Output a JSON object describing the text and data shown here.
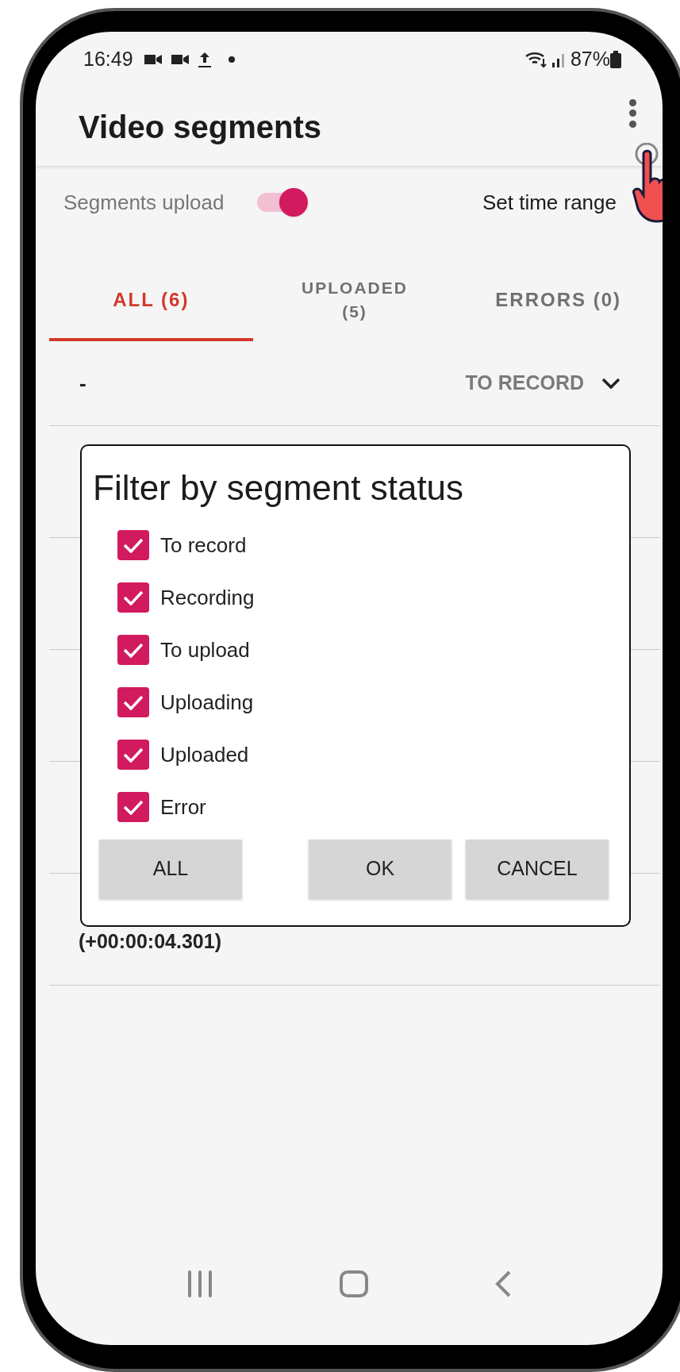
{
  "status_bar": {
    "time": "16:49",
    "battery": "87%"
  },
  "app_bar": {
    "title": "Video segments"
  },
  "controls": {
    "upload_toggle": {
      "label": "Segments upload",
      "on": true
    },
    "time_range": "Set time range"
  },
  "tabs": [
    {
      "label": "ALL (6)",
      "selected": true
    },
    {
      "label": "UPLOADED (5)",
      "selected": false
    },
    {
      "label": "ERRORS (0)",
      "selected": false
    }
  ],
  "filter_row": {
    "value": "-",
    "sort": "TO RECORD"
  },
  "segments": [
    {
      "text": "(+00:00:04.301)"
    }
  ],
  "dialog": {
    "title": "Filter by segment status",
    "options": [
      {
        "label": "To record",
        "checked": true
      },
      {
        "label": "Recording",
        "checked": true
      },
      {
        "label": "To upload",
        "checked": true
      },
      {
        "label": "Uploading",
        "checked": true
      },
      {
        "label": "Uploaded",
        "checked": true
      },
      {
        "label": "Error",
        "checked": true
      }
    ],
    "buttons": [
      "ALL",
      "OK",
      "CANCEL"
    ]
  }
}
